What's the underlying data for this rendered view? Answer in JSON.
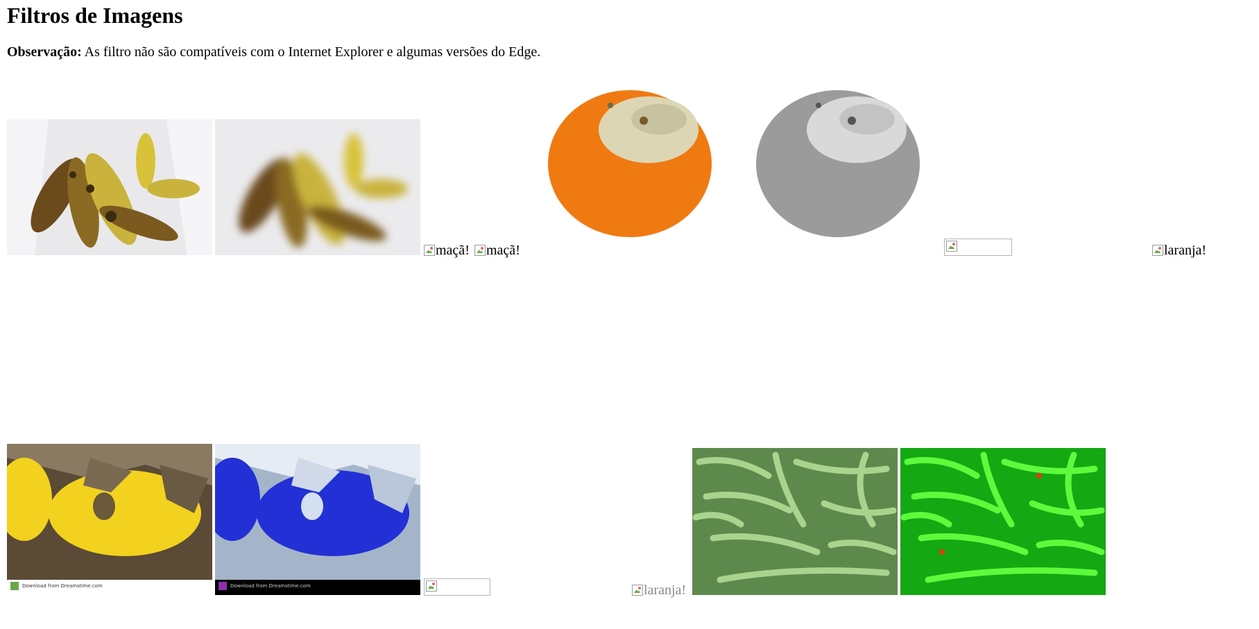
{
  "page": {
    "title": "Filtros de Imagens",
    "note_label": "Observação:",
    "note_text": " As filtro não são compatíveis com o Internet Explorer e algumas versões do Edge."
  },
  "images": {
    "banana_original": "banana",
    "banana_blur": "banana blur",
    "apple_alt_1": "maçã!",
    "apple_alt_2": "maçã!",
    "orange_original": "laranja",
    "orange_grayscale": "laranja grayscale",
    "orange_alt_1": "laranja!",
    "orange_alt_2": "laranja!",
    "melon_original": "melão",
    "melon_invert": "melão invert",
    "beans_original": "vagem",
    "beans_saturate": "vagem saturate",
    "watermark_text": "Download from Dreamstime.com"
  },
  "colors": {
    "orange": "#f07a12",
    "banana_yellow": "#d8c23a",
    "melon_yellow": "#f2d21e",
    "invert_blue": "#2330d6",
    "bean_green": "#7fb86a",
    "bean_bright": "#22e31a"
  }
}
